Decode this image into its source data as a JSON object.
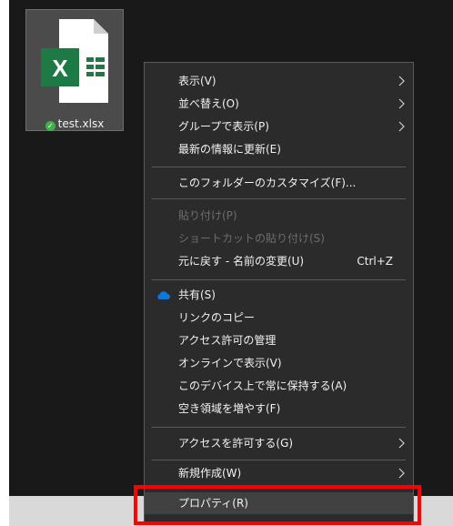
{
  "file": {
    "name": "test.xlsx",
    "icon": "excel-file-icon",
    "status_icon": "sync-check-icon",
    "icon_letter": "X"
  },
  "menu": {
    "items": [
      {
        "label": "表示(V)",
        "submenu": true
      },
      {
        "label": "並べ替え(O)",
        "submenu": true
      },
      {
        "label": "グループで表示(P)",
        "submenu": true
      },
      {
        "label": "最新の情報に更新(E)"
      },
      {
        "label": "このフォルダーのカスタマイズ(F)..."
      },
      {
        "label": "貼り付け(P)",
        "disabled": true
      },
      {
        "label": "ショートカットの貼り付け(S)",
        "disabled": true
      },
      {
        "label": "元に戻す - 名前の変更(U)",
        "shortcut": "Ctrl+Z"
      },
      {
        "label": "共有(S)",
        "icon": "onedrive-cloud-icon"
      },
      {
        "label": "リンクのコピー"
      },
      {
        "label": "アクセス許可の管理"
      },
      {
        "label": "オンラインで表示(V)"
      },
      {
        "label": "このデバイス上で常に保持する(A)"
      },
      {
        "label": "空き領域を増やす(F)"
      },
      {
        "label": "アクセスを許可する(G)",
        "submenu": true
      },
      {
        "label": "新規作成(W)",
        "submenu": true
      },
      {
        "label": "プロパティ(R)",
        "highlighted": true
      }
    ]
  },
  "colors": {
    "desktop_bg": "#191919",
    "menu_bg": "#2b2b2b",
    "highlight_box": "#ff0000",
    "excel_green": "#1d7a45",
    "onedrive_blue": "#0f78d4"
  }
}
